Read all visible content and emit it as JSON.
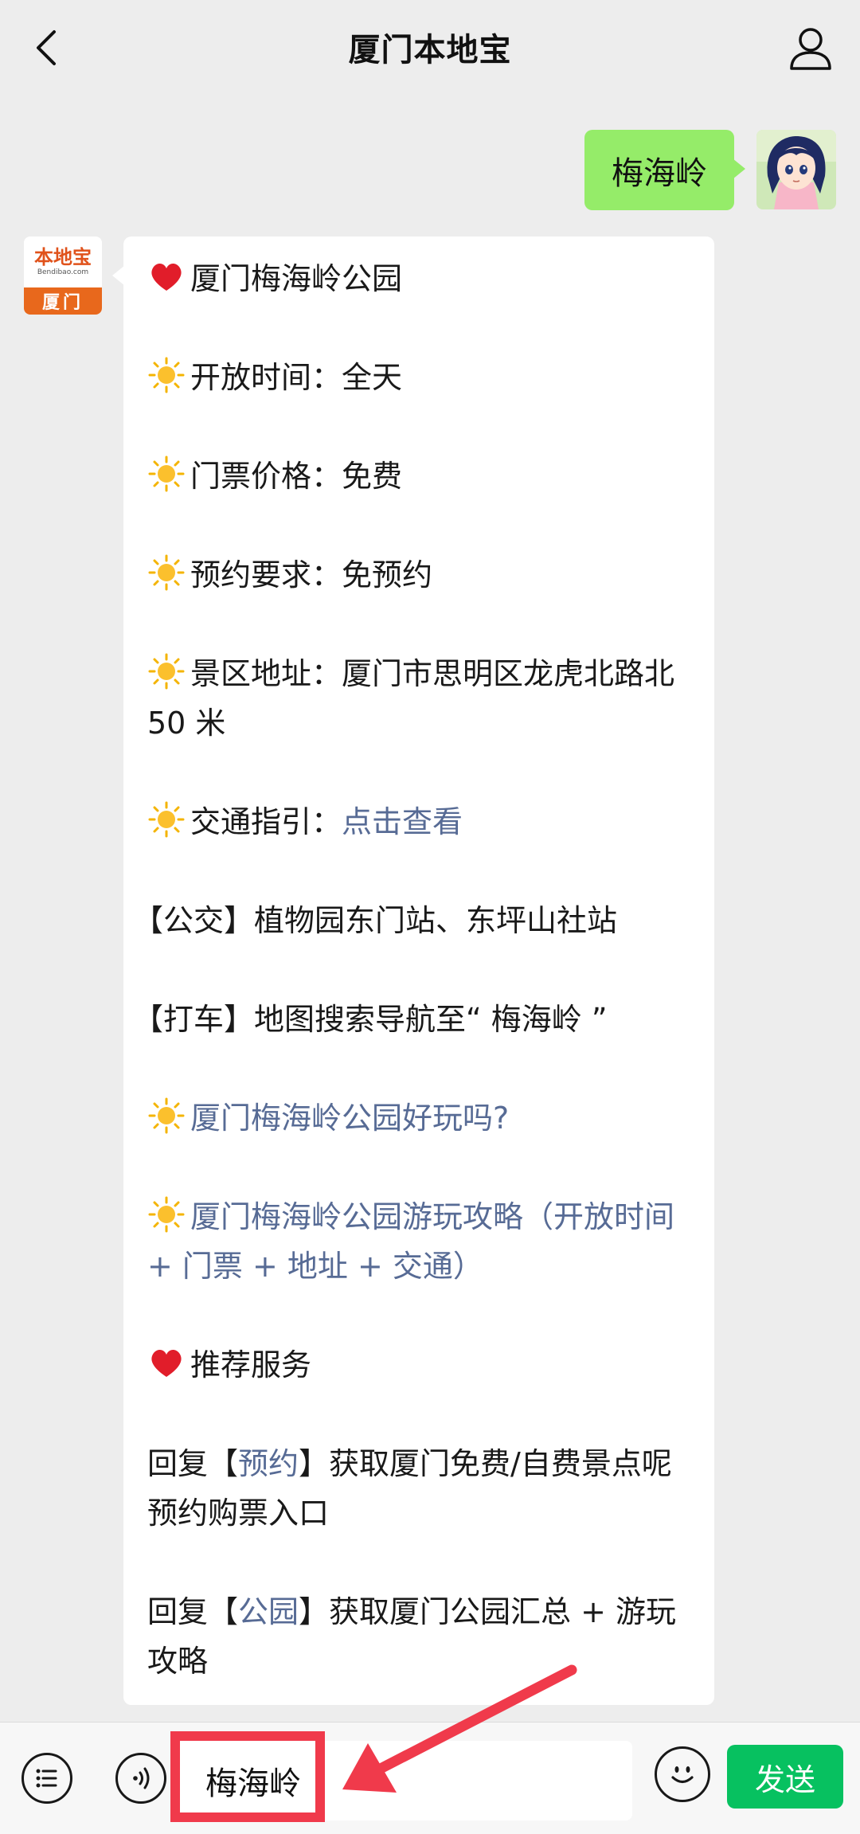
{
  "header": {
    "title": "厦门本地宝",
    "back_icon": "chevron-left-icon",
    "profile_icon": "person-icon"
  },
  "user_message": {
    "text": "梅海岭",
    "bubble_color": "#95ec69"
  },
  "bot": {
    "avatar_logo": "本地宝",
    "avatar_url": "Bendibao.com",
    "avatar_city": "厦门",
    "messages": {
      "l1": "厦门梅海岭公园",
      "l2": "开放时间：全天",
      "l3": "门票价格：免费",
      "l4": "预约要求：免预约",
      "l5": "景区地址：厦门市思明区龙虎北路北 50 米",
      "l6_prefix": "交通指引：",
      "l6_link": "点击查看",
      "l7": "【公交】植物园东门站、东坪山社站",
      "l8": "【打车】地图搜索导航至“ 梅海岭 ”",
      "l9_link": "厦门梅海岭公园好玩吗?",
      "l10_link": "厦门梅海岭公园游玩攻略（开放时间 + 门票 + 地址 + 交通）",
      "l11": "推荐服务",
      "l12_a": "回复【",
      "l12_link": "预约",
      "l12_b": "】获取厦门免费/自费景点呢预约购票入口",
      "l13_a": "回复【",
      "l13_link": "公园",
      "l13_b": "】获取厦门公园汇总 + 游玩攻略"
    },
    "link_color": "#576b95"
  },
  "input_bar": {
    "menu_icon": "list-menu-icon",
    "voice_icon": "voice-icon",
    "input_value": "梅海岭",
    "emoji_icon": "emoji-icon",
    "send_label": "发送",
    "send_color": "#07c160"
  },
  "annotation": {
    "highlight_color": "#f03a4b"
  }
}
